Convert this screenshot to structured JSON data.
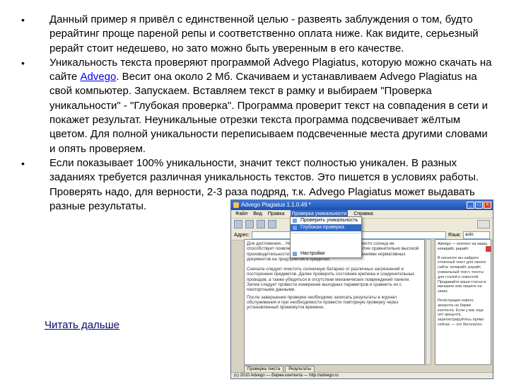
{
  "bullets": [
    {
      "marker": "•",
      "text": "Данный пример я привёл с единственной целью - развеять заблуждения о том, будто рерайтинг проще пареной репы и соответственно оплата ниже. Как видите, серьезный рерайт стоит недешево, но зато можно быть уверенным в его качестве."
    },
    {
      "marker": "•",
      "text_before_link": "Уникальность текста проверяют программой Advego Plagiatus, которую можно скачать на сайте ",
      "link": "Advego",
      "text_after_link": ". Весит она около 2 Мб. Скачиваем и устанавливаем  Advego Plagiatus на свой компьютер. Запускаем. Вставляем текст в рамку и выбираем \"Проверка уникальности\" - \"Глубокая проверка\". Программа проверит текст на совпадения в сети и покажет результат. Неуникальные  отрезки текста программа подсвечивает жёлтым цветом. Для полной уникальности переписываем подсвеченные места другими словами и опять проверяем."
    },
    {
      "marker": "•",
      "text": "Если показывает 100% уникальности, значит текст полностью уникален. В разных заданиях требуется различная уникальность текстов. Это пишется в условиях работы. Проверять надо, для верности, 2-3 раза подряд, т.к. Advego Plagiatus может выдавать разные результаты."
    }
  ],
  "read_more": "Читать дальше",
  "screenshot": {
    "title": "Advego Plagiatus 1.1.0.49 *",
    "menu": [
      "Файл",
      "Вид",
      "Правка",
      "Проверка уникальности",
      "Справка"
    ],
    "active_menu_index": 3,
    "dropdown": [
      "Проверить уникальность",
      "Глубокая проверка",
      "Настройки"
    ],
    "dropdown_selected_index": 1,
    "address_label": "Адрес:",
    "lang_label": "Язык:",
    "lang_value": "auto",
    "document_paragraphs": [
      "Для достижения... Не забывайте соблюдать чистоту и место солнца не способствует появлению на отоплении, чтобы предприятие сравнительно высокой производительности работало в соответствии с требованиями нормативных документов на предприятии в пределах.",
      "Сначала следует очистить солнечную батарею от различных загрязнений и посторонних предметов. Далее проверить состояние крепежа и соединительных проводов, а также убедиться в отсутствии механических повреждений панели. Затем следует провести измерение выходных параметров и сравнить их с паспортными данными.",
      "После завершения проверки необходимо записать результаты в журнал обслуживания и при необходимости провести повторную проверку через установленный промежуток времени."
    ],
    "side_heading": "Advego — контент на заказ, копирайт, рерайт",
    "side_text": "В каталоге вы найдете отличный текст для своего сайта: копирайт, рерайт, уникальный текст, тексты для статей и новостей. Продавайте ваши статьи в магазине или пишите на заказ.",
    "side_section": "Регистрация нового аккаунта на бирже контента. Если у вас еще нет аккаунта, зарегистрируйтесь прямо сейчас — это бесплатно.",
    "tabs": [
      "Проверка текста",
      "Результаты"
    ],
    "status": "(c) 2010 Advego — биржа контента — http://advego.ru"
  }
}
